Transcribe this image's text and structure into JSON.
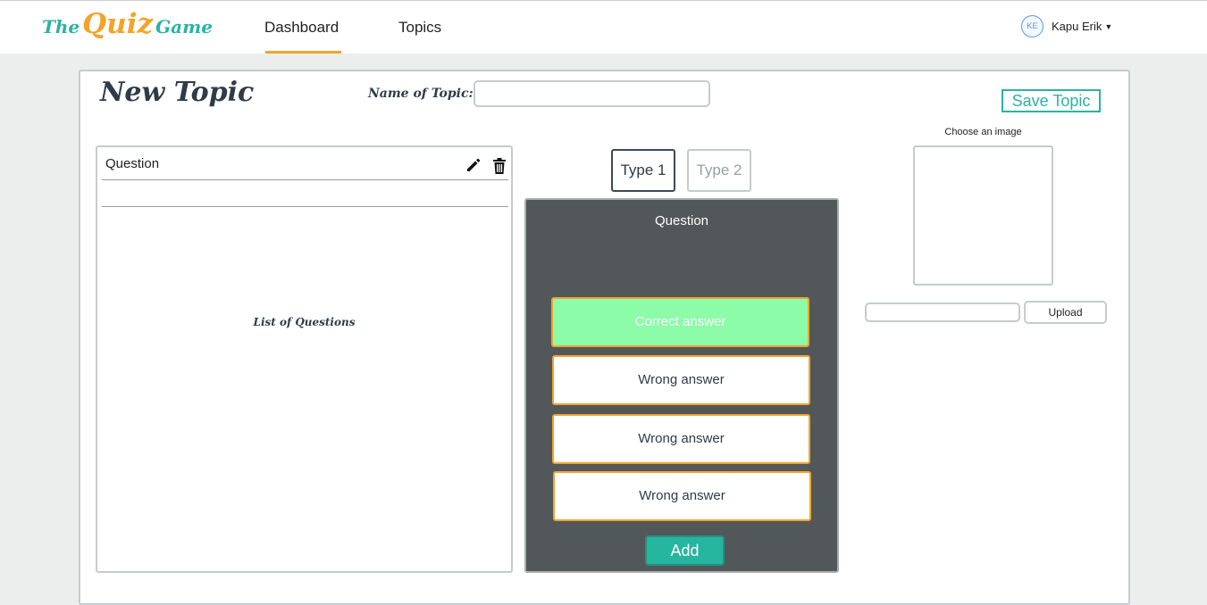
{
  "app": {
    "logo": {
      "word1": "The",
      "word2": "Quiz",
      "word3": "Game"
    }
  },
  "nav": {
    "items": [
      {
        "label": "Dashboard",
        "active": true
      },
      {
        "label": "Topics",
        "active": false
      }
    ]
  },
  "user": {
    "initials": "KE",
    "name": "Kapu Erik"
  },
  "page": {
    "title": "New Topic",
    "topic_name_label": "Name of Topic:",
    "topic_name_value": "",
    "save_label": "Save Topic"
  },
  "question_list": {
    "rows": [
      {
        "label": "Question"
      }
    ],
    "placeholder": "List of Questions"
  },
  "editor": {
    "type_tabs": [
      {
        "label": "Type 1",
        "active": true
      },
      {
        "label": "Type 2",
        "active": false
      }
    ],
    "question_label": "Question",
    "answers": [
      {
        "label": "Correct answer",
        "correct": true
      },
      {
        "label": "Wrong answer",
        "correct": false
      },
      {
        "label": "Wrong answer",
        "correct": false
      },
      {
        "label": "Wrong answer",
        "correct": false
      }
    ],
    "add_label": "Add"
  },
  "image": {
    "label": "Choose an image",
    "file_value": "",
    "upload_label": "Upload"
  },
  "colors": {
    "accent_teal": "#2ab3a3",
    "accent_orange": "#f3a32c",
    "editor_bg": "#525859",
    "correct_bg": "#8cfca8"
  }
}
